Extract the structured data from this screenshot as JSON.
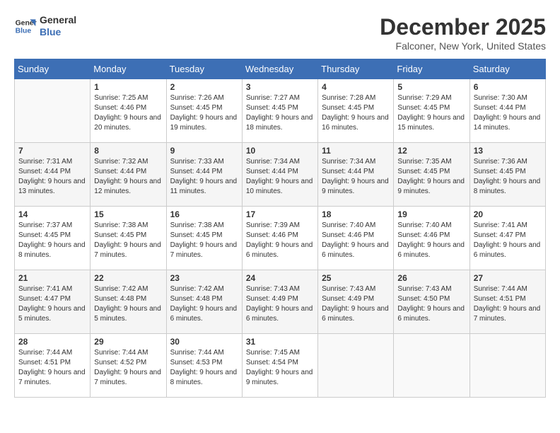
{
  "header": {
    "logo_line1": "General",
    "logo_line2": "Blue",
    "title": "December 2025",
    "subtitle": "Falconer, New York, United States"
  },
  "days_of_week": [
    "Sunday",
    "Monday",
    "Tuesday",
    "Wednesday",
    "Thursday",
    "Friday",
    "Saturday"
  ],
  "weeks": [
    [
      {
        "day": "",
        "sunrise": "",
        "sunset": "",
        "daylight": ""
      },
      {
        "day": "1",
        "sunrise": "Sunrise: 7:25 AM",
        "sunset": "Sunset: 4:46 PM",
        "daylight": "Daylight: 9 hours and 20 minutes."
      },
      {
        "day": "2",
        "sunrise": "Sunrise: 7:26 AM",
        "sunset": "Sunset: 4:45 PM",
        "daylight": "Daylight: 9 hours and 19 minutes."
      },
      {
        "day": "3",
        "sunrise": "Sunrise: 7:27 AM",
        "sunset": "Sunset: 4:45 PM",
        "daylight": "Daylight: 9 hours and 18 minutes."
      },
      {
        "day": "4",
        "sunrise": "Sunrise: 7:28 AM",
        "sunset": "Sunset: 4:45 PM",
        "daylight": "Daylight: 9 hours and 16 minutes."
      },
      {
        "day": "5",
        "sunrise": "Sunrise: 7:29 AM",
        "sunset": "Sunset: 4:45 PM",
        "daylight": "Daylight: 9 hours and 15 minutes."
      },
      {
        "day": "6",
        "sunrise": "Sunrise: 7:30 AM",
        "sunset": "Sunset: 4:44 PM",
        "daylight": "Daylight: 9 hours and 14 minutes."
      }
    ],
    [
      {
        "day": "7",
        "sunrise": "Sunrise: 7:31 AM",
        "sunset": "Sunset: 4:44 PM",
        "daylight": "Daylight: 9 hours and 13 minutes."
      },
      {
        "day": "8",
        "sunrise": "Sunrise: 7:32 AM",
        "sunset": "Sunset: 4:44 PM",
        "daylight": "Daylight: 9 hours and 12 minutes."
      },
      {
        "day": "9",
        "sunrise": "Sunrise: 7:33 AM",
        "sunset": "Sunset: 4:44 PM",
        "daylight": "Daylight: 9 hours and 11 minutes."
      },
      {
        "day": "10",
        "sunrise": "Sunrise: 7:34 AM",
        "sunset": "Sunset: 4:44 PM",
        "daylight": "Daylight: 9 hours and 10 minutes."
      },
      {
        "day": "11",
        "sunrise": "Sunrise: 7:34 AM",
        "sunset": "Sunset: 4:44 PM",
        "daylight": "Daylight: 9 hours and 9 minutes."
      },
      {
        "day": "12",
        "sunrise": "Sunrise: 7:35 AM",
        "sunset": "Sunset: 4:45 PM",
        "daylight": "Daylight: 9 hours and 9 minutes."
      },
      {
        "day": "13",
        "sunrise": "Sunrise: 7:36 AM",
        "sunset": "Sunset: 4:45 PM",
        "daylight": "Daylight: 9 hours and 8 minutes."
      }
    ],
    [
      {
        "day": "14",
        "sunrise": "Sunrise: 7:37 AM",
        "sunset": "Sunset: 4:45 PM",
        "daylight": "Daylight: 9 hours and 8 minutes."
      },
      {
        "day": "15",
        "sunrise": "Sunrise: 7:38 AM",
        "sunset": "Sunset: 4:45 PM",
        "daylight": "Daylight: 9 hours and 7 minutes."
      },
      {
        "day": "16",
        "sunrise": "Sunrise: 7:38 AM",
        "sunset": "Sunset: 4:45 PM",
        "daylight": "Daylight: 9 hours and 7 minutes."
      },
      {
        "day": "17",
        "sunrise": "Sunrise: 7:39 AM",
        "sunset": "Sunset: 4:46 PM",
        "daylight": "Daylight: 9 hours and 6 minutes."
      },
      {
        "day": "18",
        "sunrise": "Sunrise: 7:40 AM",
        "sunset": "Sunset: 4:46 PM",
        "daylight": "Daylight: 9 hours and 6 minutes."
      },
      {
        "day": "19",
        "sunrise": "Sunrise: 7:40 AM",
        "sunset": "Sunset: 4:46 PM",
        "daylight": "Daylight: 9 hours and 6 minutes."
      },
      {
        "day": "20",
        "sunrise": "Sunrise: 7:41 AM",
        "sunset": "Sunset: 4:47 PM",
        "daylight": "Daylight: 9 hours and 6 minutes."
      }
    ],
    [
      {
        "day": "21",
        "sunrise": "Sunrise: 7:41 AM",
        "sunset": "Sunset: 4:47 PM",
        "daylight": "Daylight: 9 hours and 5 minutes."
      },
      {
        "day": "22",
        "sunrise": "Sunrise: 7:42 AM",
        "sunset": "Sunset: 4:48 PM",
        "daylight": "Daylight: 9 hours and 5 minutes."
      },
      {
        "day": "23",
        "sunrise": "Sunrise: 7:42 AM",
        "sunset": "Sunset: 4:48 PM",
        "daylight": "Daylight: 9 hours and 6 minutes."
      },
      {
        "day": "24",
        "sunrise": "Sunrise: 7:43 AM",
        "sunset": "Sunset: 4:49 PM",
        "daylight": "Daylight: 9 hours and 6 minutes."
      },
      {
        "day": "25",
        "sunrise": "Sunrise: 7:43 AM",
        "sunset": "Sunset: 4:49 PM",
        "daylight": "Daylight: 9 hours and 6 minutes."
      },
      {
        "day": "26",
        "sunrise": "Sunrise: 7:43 AM",
        "sunset": "Sunset: 4:50 PM",
        "daylight": "Daylight: 9 hours and 6 minutes."
      },
      {
        "day": "27",
        "sunrise": "Sunrise: 7:44 AM",
        "sunset": "Sunset: 4:51 PM",
        "daylight": "Daylight: 9 hours and 7 minutes."
      }
    ],
    [
      {
        "day": "28",
        "sunrise": "Sunrise: 7:44 AM",
        "sunset": "Sunset: 4:51 PM",
        "daylight": "Daylight: 9 hours and 7 minutes."
      },
      {
        "day": "29",
        "sunrise": "Sunrise: 7:44 AM",
        "sunset": "Sunset: 4:52 PM",
        "daylight": "Daylight: 9 hours and 7 minutes."
      },
      {
        "day": "30",
        "sunrise": "Sunrise: 7:44 AM",
        "sunset": "Sunset: 4:53 PM",
        "daylight": "Daylight: 9 hours and 8 minutes."
      },
      {
        "day": "31",
        "sunrise": "Sunrise: 7:45 AM",
        "sunset": "Sunset: 4:54 PM",
        "daylight": "Daylight: 9 hours and 9 minutes."
      },
      {
        "day": "",
        "sunrise": "",
        "sunset": "",
        "daylight": ""
      },
      {
        "day": "",
        "sunrise": "",
        "sunset": "",
        "daylight": ""
      },
      {
        "day": "",
        "sunrise": "",
        "sunset": "",
        "daylight": ""
      }
    ]
  ]
}
